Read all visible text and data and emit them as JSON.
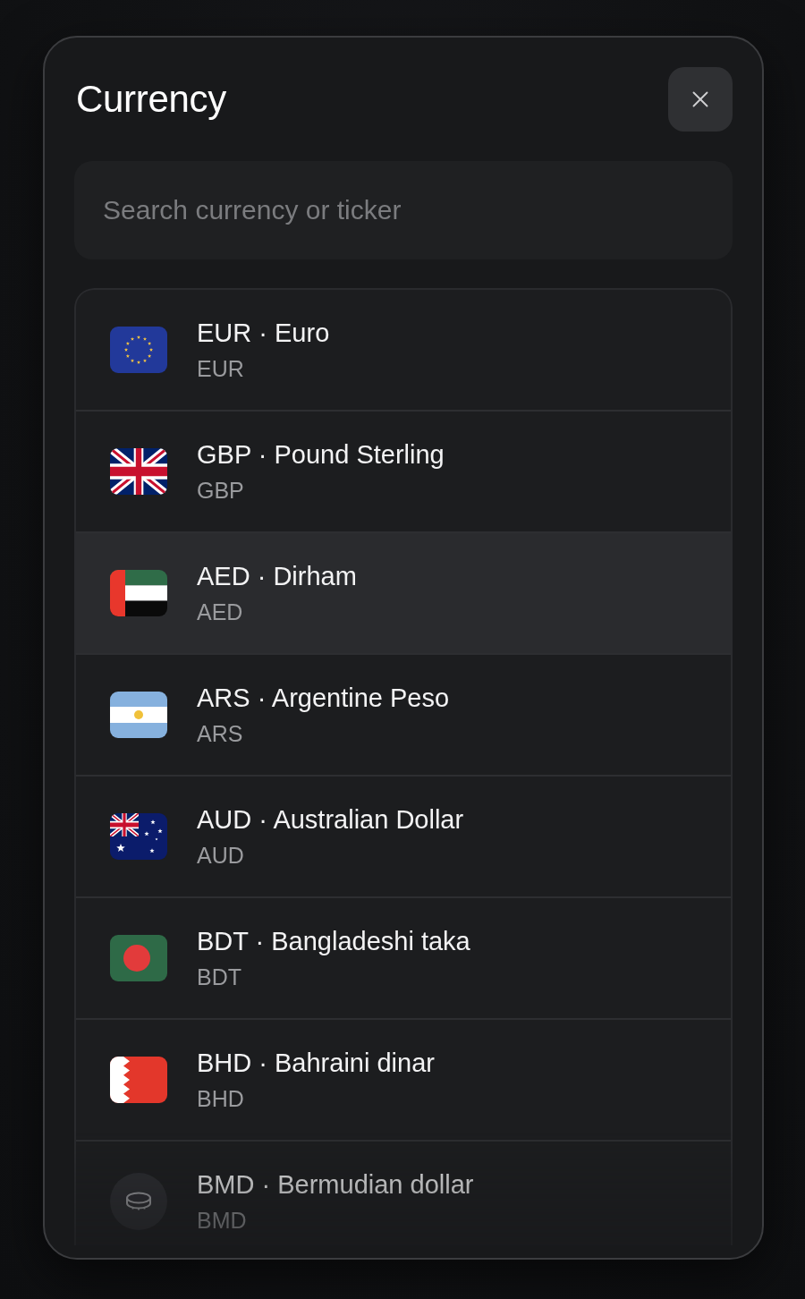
{
  "dialog": {
    "title": "Currency",
    "search": {
      "placeholder": "Search currency or ticker"
    },
    "currencies": [
      {
        "kind": "eu",
        "name": "EUR · Euro",
        "code": "EUR",
        "selected": false
      },
      {
        "kind": "gb",
        "name": "GBP · Pound Sterling",
        "code": "GBP",
        "selected": false
      },
      {
        "kind": "ae",
        "name": "AED · Dirham",
        "code": "AED",
        "selected": true
      },
      {
        "kind": "ar",
        "name": "ARS · Argentine Peso",
        "code": "ARS",
        "selected": false
      },
      {
        "kind": "au",
        "name": "AUD · Australian Dollar",
        "code": "AUD",
        "selected": false
      },
      {
        "kind": "bd",
        "name": "BDT · Bangladeshi taka",
        "code": "BDT",
        "selected": false
      },
      {
        "kind": "bh",
        "name": "BHD · Bahraini dinar",
        "code": "BHD",
        "selected": false
      },
      {
        "kind": "coin",
        "name": "BMD · Bermudian dollar",
        "code": "BMD",
        "selected": false
      }
    ]
  }
}
